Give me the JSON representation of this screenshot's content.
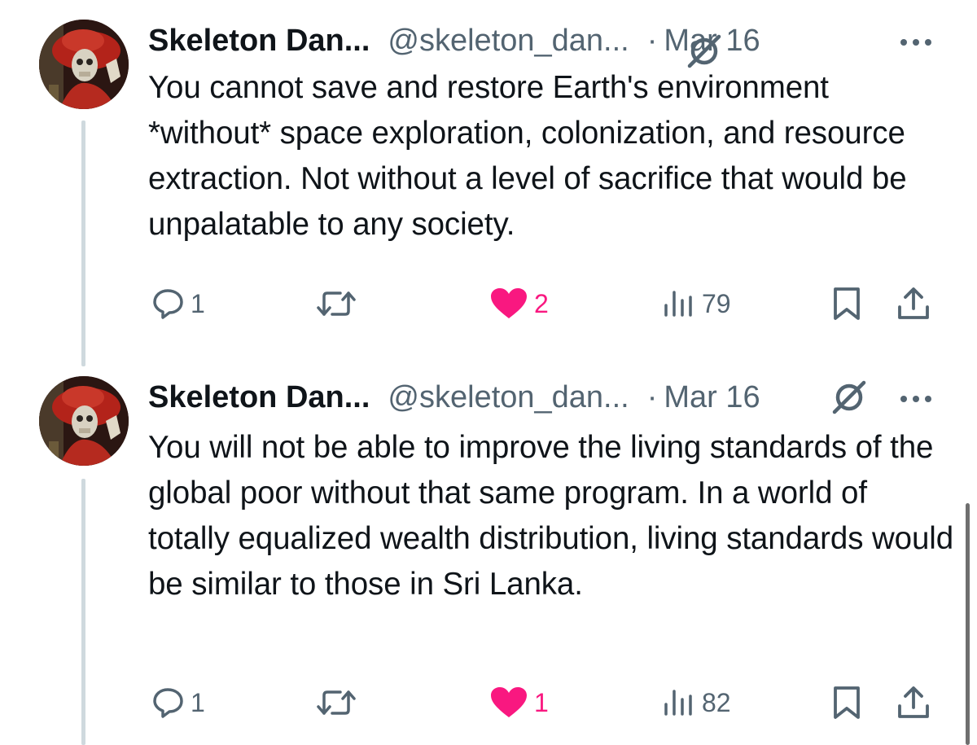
{
  "tweets": [
    {
      "author_name": "Skeleton Dan...",
      "handle": "@skeleton_dan...",
      "separator": "·",
      "date": "Mar 16",
      "text": "You cannot save and restore Earth's environment *without* space exploration, colonization, and resource extraction. Not without a level of sacrifice that would be unpalatable to any society.",
      "replies": "1",
      "reposts": "",
      "likes": "2",
      "views": "79",
      "liked": true
    },
    {
      "author_name": "Skeleton Dan...",
      "handle": "@skeleton_dan...",
      "separator": "·",
      "date": "Mar 16",
      "text": "You will not be able to improve the living standards of the global poor without that same program. In a world of totally equalized wealth distribution, living standards would be similar to those in Sri Lanka.",
      "replies": "1",
      "reposts": "",
      "likes": "1",
      "views": "82",
      "liked": true
    }
  ],
  "colors": {
    "text_primary": "#0f1419",
    "text_secondary": "#536471",
    "like_pink": "#f91880",
    "thread_line": "#cfd9de"
  },
  "icons": {
    "reply": "speech-bubble-icon",
    "repost": "repost-arrows-icon",
    "like": "heart-filled-icon",
    "views": "bar-chart-icon",
    "bookmark": "bookmark-icon",
    "share": "share-upload-icon",
    "grok": "grok-slash-circle-icon",
    "more": "more-dots-icon"
  }
}
